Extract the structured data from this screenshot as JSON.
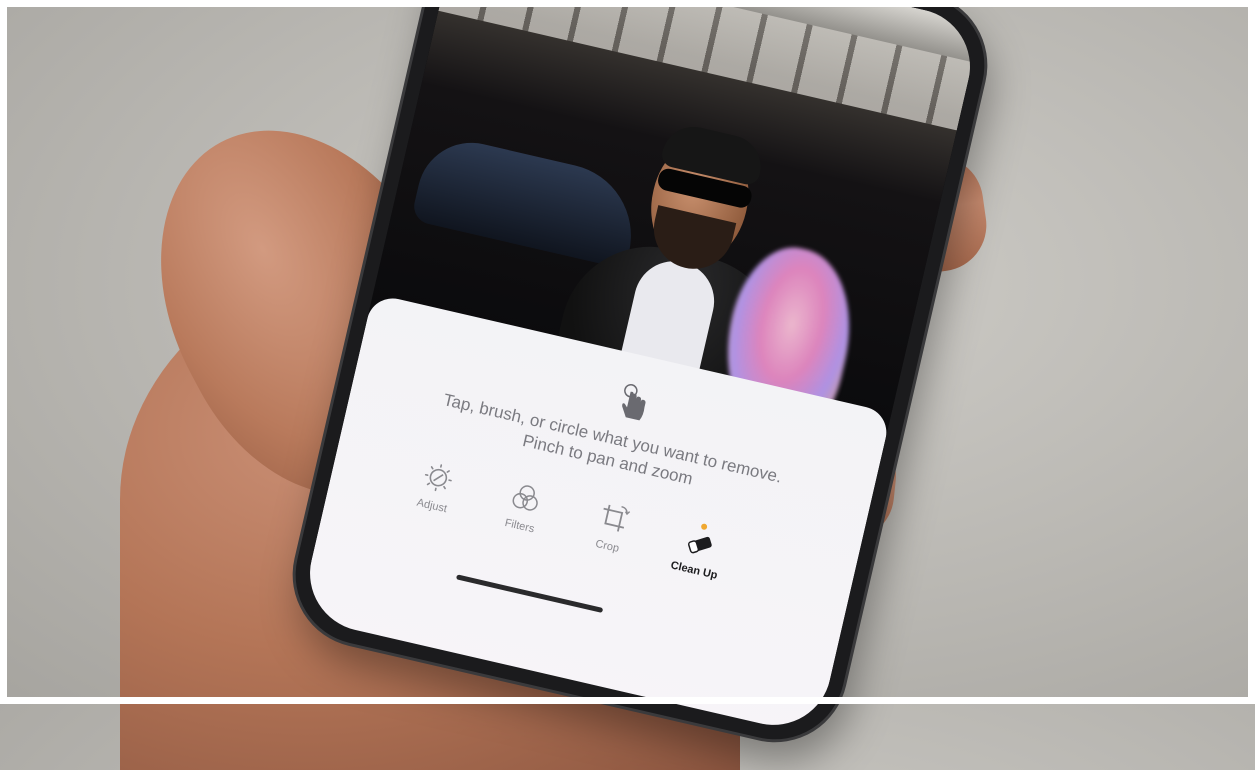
{
  "editor": {
    "hint": {
      "line1": "Tap, brush, or circle what you want to remove.",
      "line2": "Pinch to pan and zoom",
      "icon": "hand-tap-icon"
    },
    "tools": [
      {
        "label": "Adjust",
        "icon": "adjust-dial-icon"
      },
      {
        "label": "Filters",
        "icon": "filters-circles-icon"
      },
      {
        "label": "Crop",
        "icon": "crop-rotate-icon"
      },
      {
        "label": "Clean Up",
        "icon": "eraser-icon",
        "active": true
      }
    ]
  },
  "colors": {
    "sheet_bg": "#f3f3f6",
    "hint_text": "#7a7a80",
    "active_label": "#1c1c1e",
    "active_dot": "#f0a830",
    "inactive_label": "#8a8a8f"
  }
}
